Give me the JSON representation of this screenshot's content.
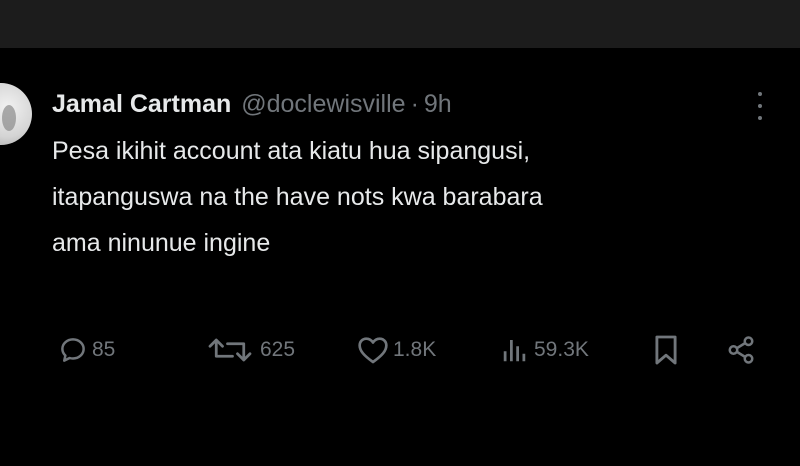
{
  "tweet": {
    "display_name": "Jamal Cartman",
    "handle": "@doclewisville",
    "separator": "·",
    "time": "9h",
    "body_lines": [
      "Pesa ikihit account ata kiatu hua sipangusi,",
      "itapanguswa na the have nots kwa barabara",
      "ama ninunue ingine"
    ]
  },
  "actions": {
    "replies": "85",
    "reposts": "625",
    "likes": "1.8K",
    "views": "59.3K"
  },
  "icons": {
    "reply": "reply-icon",
    "repost": "repost-icon",
    "like": "heart-icon",
    "views": "views-icon",
    "bookmark": "bookmark-icon",
    "share": "share-icon",
    "more": "more-icon"
  },
  "colors": {
    "background": "#000000",
    "top_band": "#1c1c1c",
    "primary_text": "#e7e9ea",
    "secondary_text": "#71767b"
  }
}
